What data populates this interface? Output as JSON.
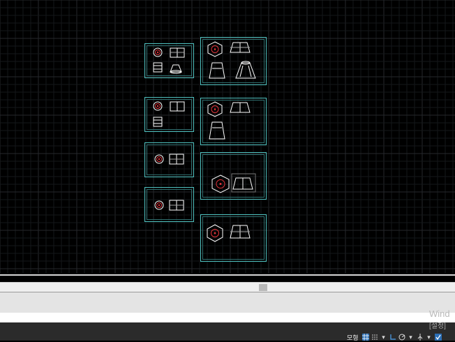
{
  "status_bar": {
    "model_label": "모형",
    "icons": [
      "grid-icon",
      "snap-grid-icon",
      "dropdown-arrow-icon",
      "ortho-icon",
      "polar-icon",
      "dropdown-arrow-icon",
      "osnap-icon",
      "dropdown-arrow-icon",
      "check-icon"
    ]
  },
  "watermark": {
    "title": "Wind",
    "subtitle": "[설정]"
  },
  "colors": {
    "background": "#000000",
    "sheet_border": "#4fc2c0",
    "part_stroke": "#ffffff",
    "center_mark": "#e0343a",
    "dim": "#b0b0b0"
  }
}
